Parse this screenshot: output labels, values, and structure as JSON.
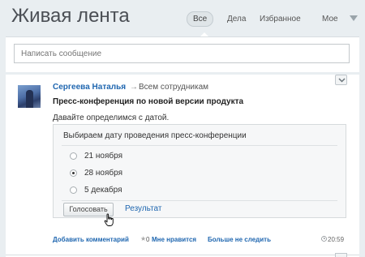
{
  "header": {
    "title": "Живая лента",
    "tabs": [
      {
        "label": "Все",
        "active": true
      },
      {
        "label": "Дела",
        "active": false
      },
      {
        "label": "Избранное",
        "active": false
      },
      {
        "label": "Мое",
        "active": false
      }
    ],
    "more_icon": "chevron-down-icon"
  },
  "composer": {
    "placeholder": "Написать сообщение"
  },
  "post": {
    "author": "Сергеева Наталья",
    "arrow": "→",
    "recipients": "Всем сотрудникам",
    "title": "Пресс-конференция по новой версии продукта",
    "text": "Давайте определимся с датой.",
    "vote": {
      "question": "Выбираем дату проведения пресс-конференции",
      "options": [
        {
          "label": "21 ноября",
          "checked": false
        },
        {
          "label": "28 ноября",
          "checked": true
        },
        {
          "label": "5 декабря",
          "checked": false
        }
      ],
      "vote_button": "Голосовать",
      "results_link": "Результат"
    },
    "footer": {
      "add_comment": "Добавить комментарий",
      "star": "★",
      "likes_count": "0",
      "like": "Мне нравится",
      "unfollow": "Больше не следить",
      "time": "20:59"
    }
  },
  "colors": {
    "link": "#2067b0",
    "background": "#e9eef1"
  }
}
